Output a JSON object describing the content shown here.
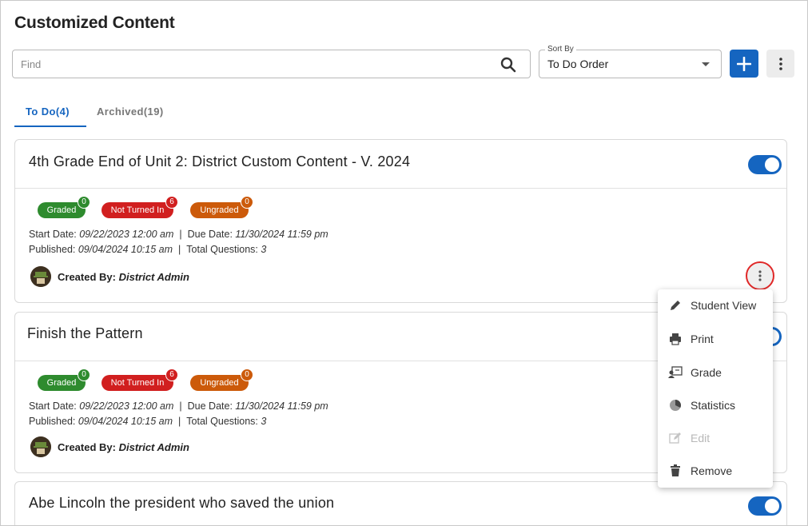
{
  "page": {
    "title": "Customized Content"
  },
  "search": {
    "placeholder": "Find"
  },
  "sort": {
    "label": "Sort By",
    "value": "To Do Order"
  },
  "tabs": [
    {
      "label": "To Do(4)",
      "active": true
    },
    {
      "label": "Archived(19)",
      "active": false
    }
  ],
  "colors": {
    "accent": "#1565c0",
    "graded": "#2e8b2e",
    "not_turned_in": "#d11f1f",
    "ungraded": "#cc5a0a"
  },
  "cards": [
    {
      "title": "4th Grade End of Unit 2: District Custom Content - V. 2024",
      "enabled": true,
      "badges": [
        {
          "label": "Graded",
          "count": "0"
        },
        {
          "label": "Not Turned In",
          "count": "6"
        },
        {
          "label": "Ungraded",
          "count": "0"
        }
      ],
      "start_label": "Start Date:",
      "start_value": "09/22/2023 12:00 am",
      "due_label": "Due Date:",
      "due_value": "11/30/2024 11:59 pm",
      "published_label": "Published:",
      "published_value": "09/04/2024 10:15 am",
      "questions_label": "Total Questions:",
      "questions_value": "3",
      "created_label": "Created By:",
      "created_value": "District Admin"
    },
    {
      "title": "Finish the Pattern",
      "enabled": true,
      "badges": [
        {
          "label": "Graded",
          "count": "0"
        },
        {
          "label": "Not Turned In",
          "count": "6"
        },
        {
          "label": "Ungraded",
          "count": "0"
        }
      ],
      "start_label": "Start Date:",
      "start_value": "09/22/2023 12:00 am",
      "due_label": "Due Date:",
      "due_value": "11/30/2024 11:59 pm",
      "published_label": "Published:",
      "published_value": "09/04/2024 10:15 am",
      "questions_label": "Total Questions:",
      "questions_value": "3",
      "created_label": "Created By:",
      "created_value": "District Admin"
    },
    {
      "title": "Abe Lincoln the president who saved the union",
      "enabled": true
    }
  ],
  "menu": {
    "items": [
      {
        "label": "Student View",
        "icon": "pencil-icon",
        "enabled": true
      },
      {
        "label": "Print",
        "icon": "printer-icon",
        "enabled": true
      },
      {
        "label": "Grade",
        "icon": "grade-icon",
        "enabled": true
      },
      {
        "label": "Statistics",
        "icon": "pie-chart-icon",
        "enabled": true
      },
      {
        "label": "Edit",
        "icon": "edit-icon",
        "enabled": false
      },
      {
        "label": "Remove",
        "icon": "trash-icon",
        "enabled": true
      }
    ]
  }
}
